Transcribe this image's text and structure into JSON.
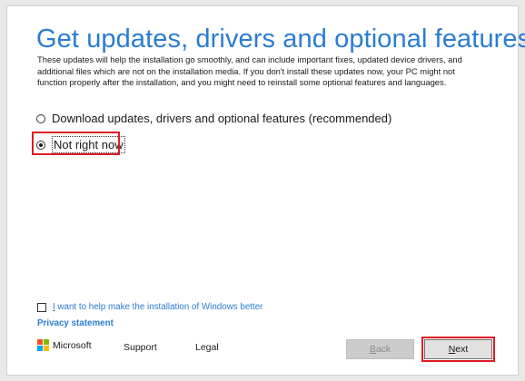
{
  "header": {
    "title": "Get updates, drivers and optional features",
    "description": "These updates will help the installation go smoothly, and can include important fixes, updated device drivers, and additional files which are not on the installation media. If you don't install these updates now, your PC might not function properly after the installation, and you might need to reinstall some optional features and languages."
  },
  "options": [
    {
      "label": "Download updates, drivers and optional features (recommended)",
      "selected": false
    },
    {
      "label": "Not right now",
      "selected": true
    }
  ],
  "consent": {
    "first_char": "I",
    "rest": " want to help make the installation of Windows better",
    "checked": false
  },
  "privacy_link": "Privacy statement",
  "footer": {
    "brand": "Microsoft",
    "support": "Support",
    "legal": "Legal",
    "back_access": "B",
    "back_rest": "ack",
    "next_access": "N",
    "next_rest": "ext"
  },
  "colors": {
    "accent": "#2b7cd3",
    "highlight": "#e01b24",
    "logo_red": "#f25022",
    "logo_green": "#7fba00",
    "logo_blue": "#00a4ef",
    "logo_yellow": "#ffb900"
  },
  "icons": {
    "radio_unselected": "radio-unselected-icon",
    "radio_selected": "radio-selected-icon",
    "checkbox": "checkbox-icon",
    "logo": "microsoft-logo-icon"
  }
}
